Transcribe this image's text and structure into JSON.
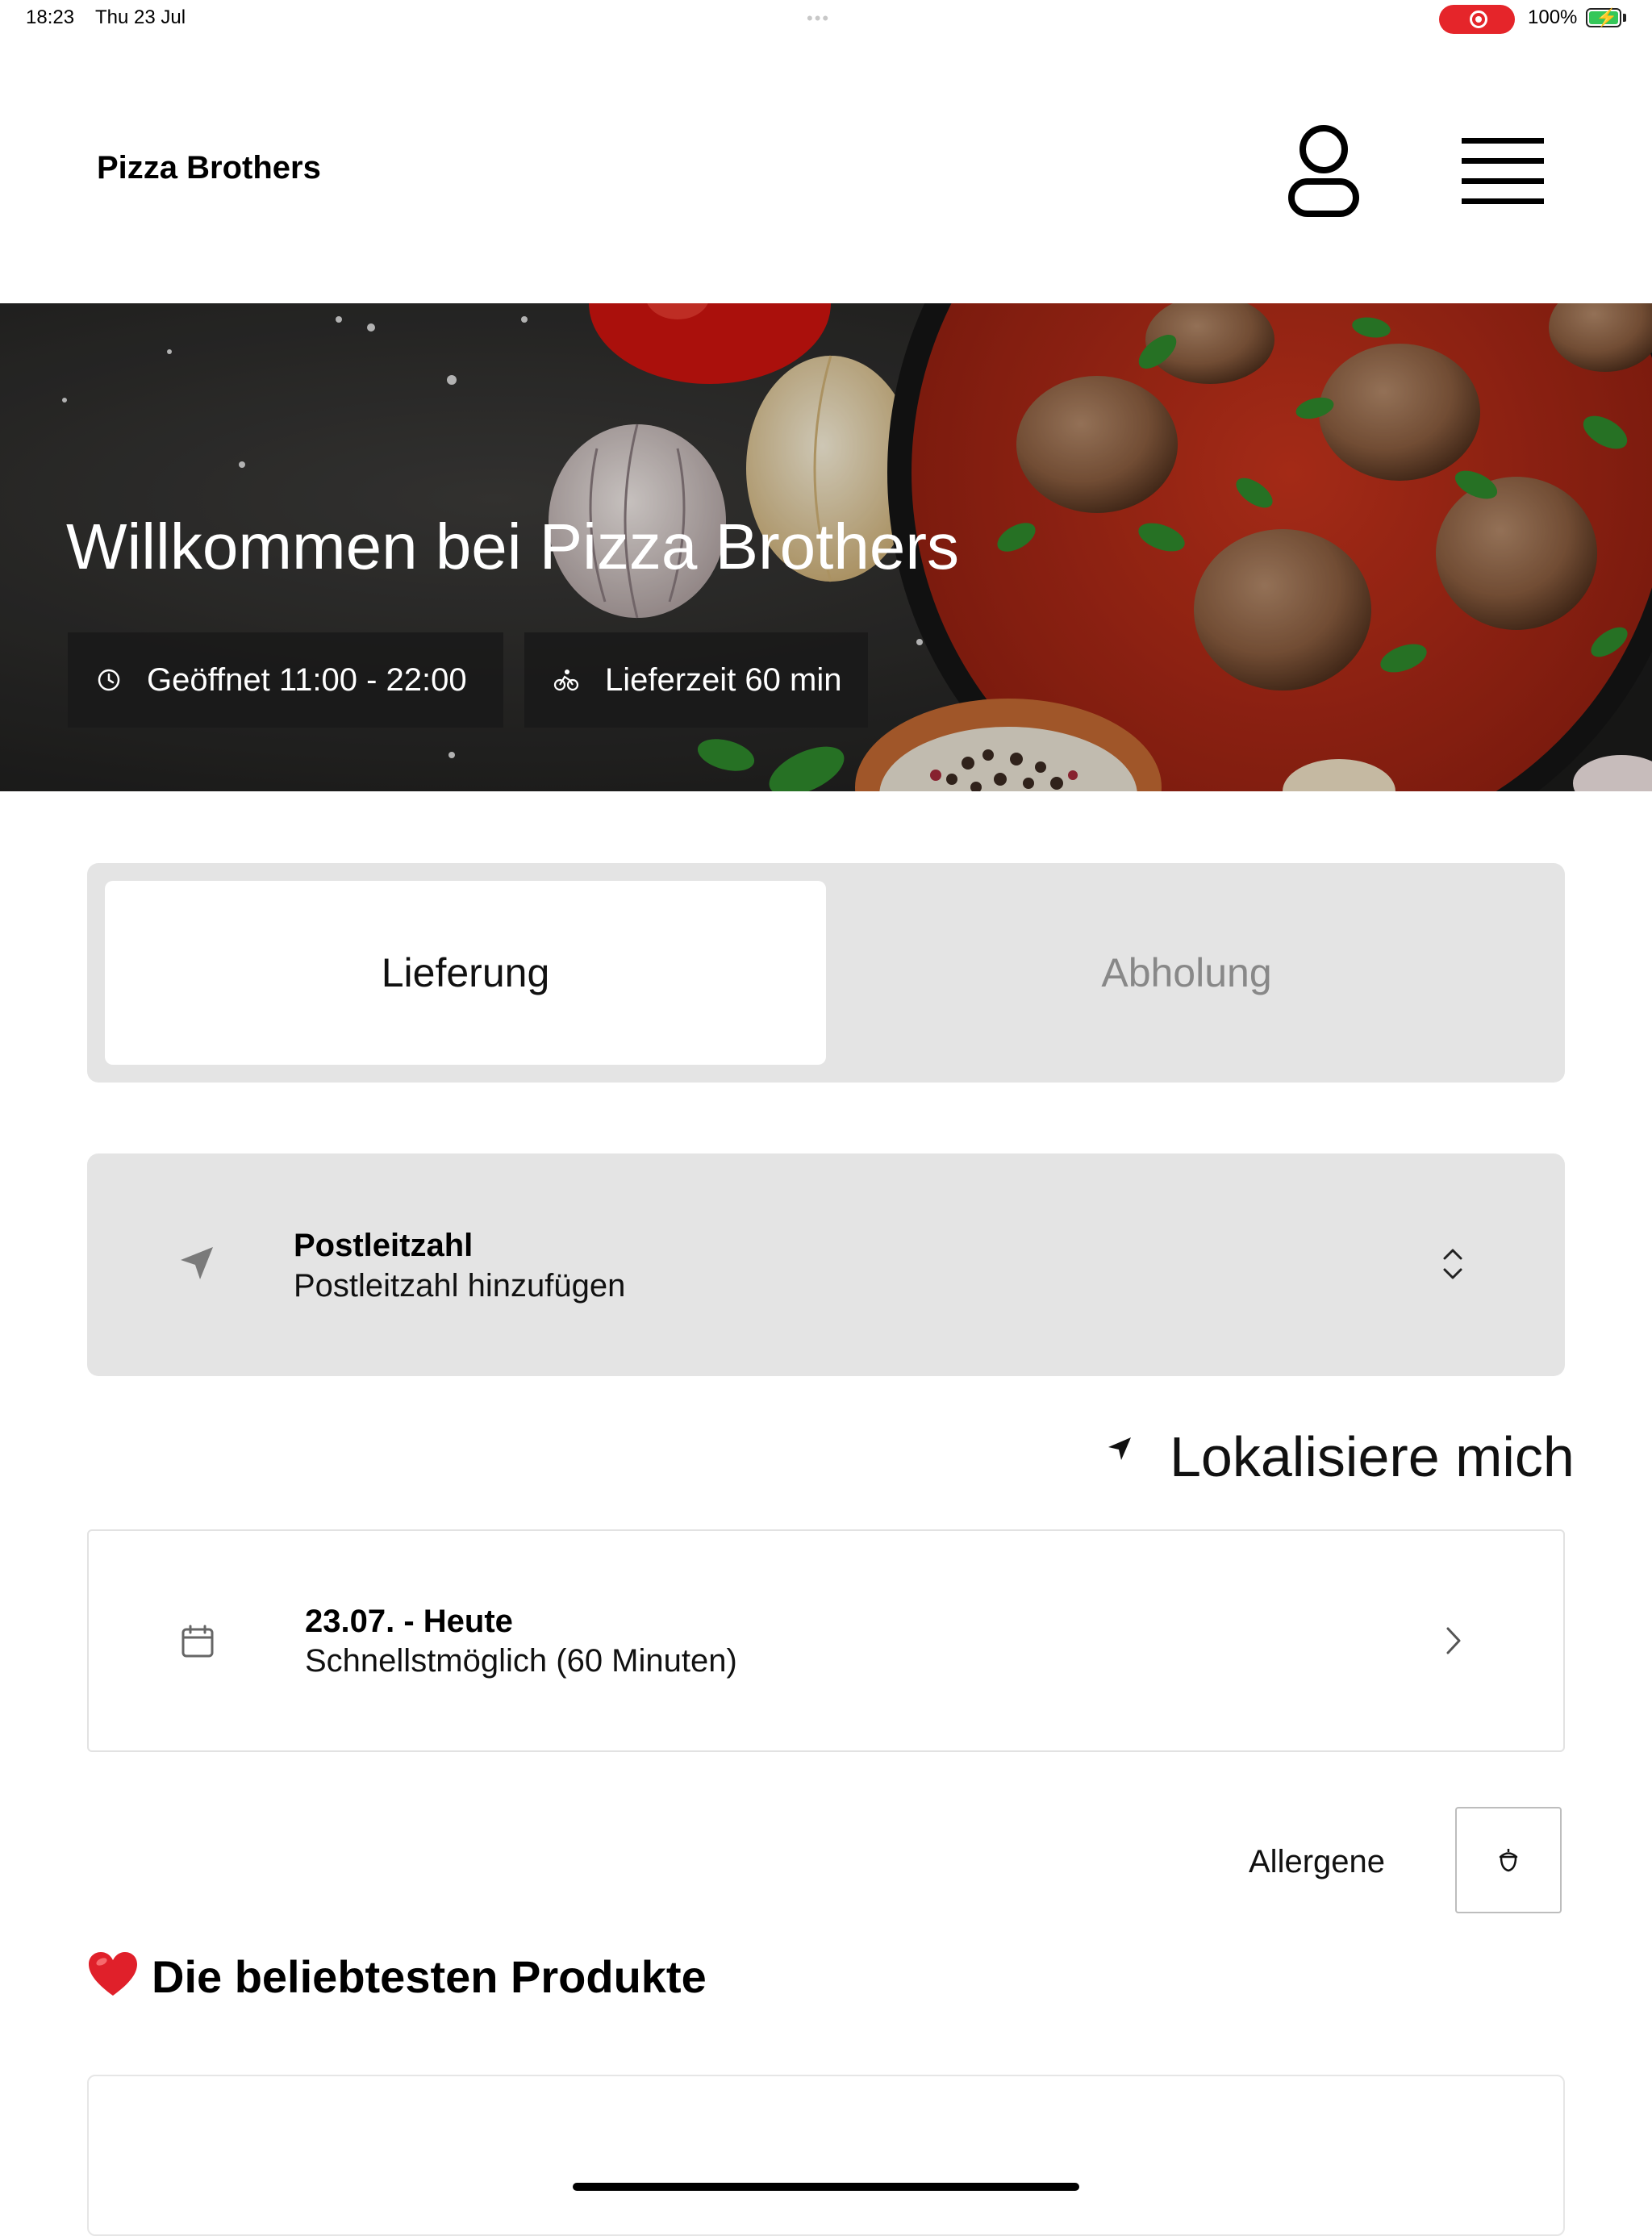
{
  "status_bar": {
    "time": "18:23",
    "date": "Thu 23 Jul",
    "battery": "100%",
    "recording_color": "#e5252a",
    "battery_color": "#34c759"
  },
  "header": {
    "brand": "Pizza Brothers",
    "profile_icon": "user-icon",
    "menu_icon": "hamburger-icon"
  },
  "hero": {
    "title": "Willkommen bei Pizza Brothers",
    "opening_hours": "Geöffnet 11:00 - 22:00",
    "delivery_time": "Lieferzeit 60 min",
    "opening_icon": "clock-icon",
    "delivery_icon": "bicycle-icon"
  },
  "order_type": {
    "options": [
      "Lieferung",
      "Abholung"
    ],
    "selected": "Lieferung"
  },
  "postal": {
    "label": "Postleitzahl",
    "value": "Postleitzahl hinzufügen",
    "icon": "location-arrow-icon"
  },
  "localize": {
    "label": "Lokalisiere mich",
    "icon": "location-arrow-icon"
  },
  "delivery_date": {
    "label": "23.07. - Heute",
    "value": "Schnellstmöglich (60 Minuten)",
    "icon": "calendar-icon"
  },
  "allergens": {
    "label": "Allergene",
    "icon": "acorn-icon"
  },
  "popular": {
    "emoji_icon": "heart-icon",
    "title": "Die beliebtesten Produkte"
  }
}
